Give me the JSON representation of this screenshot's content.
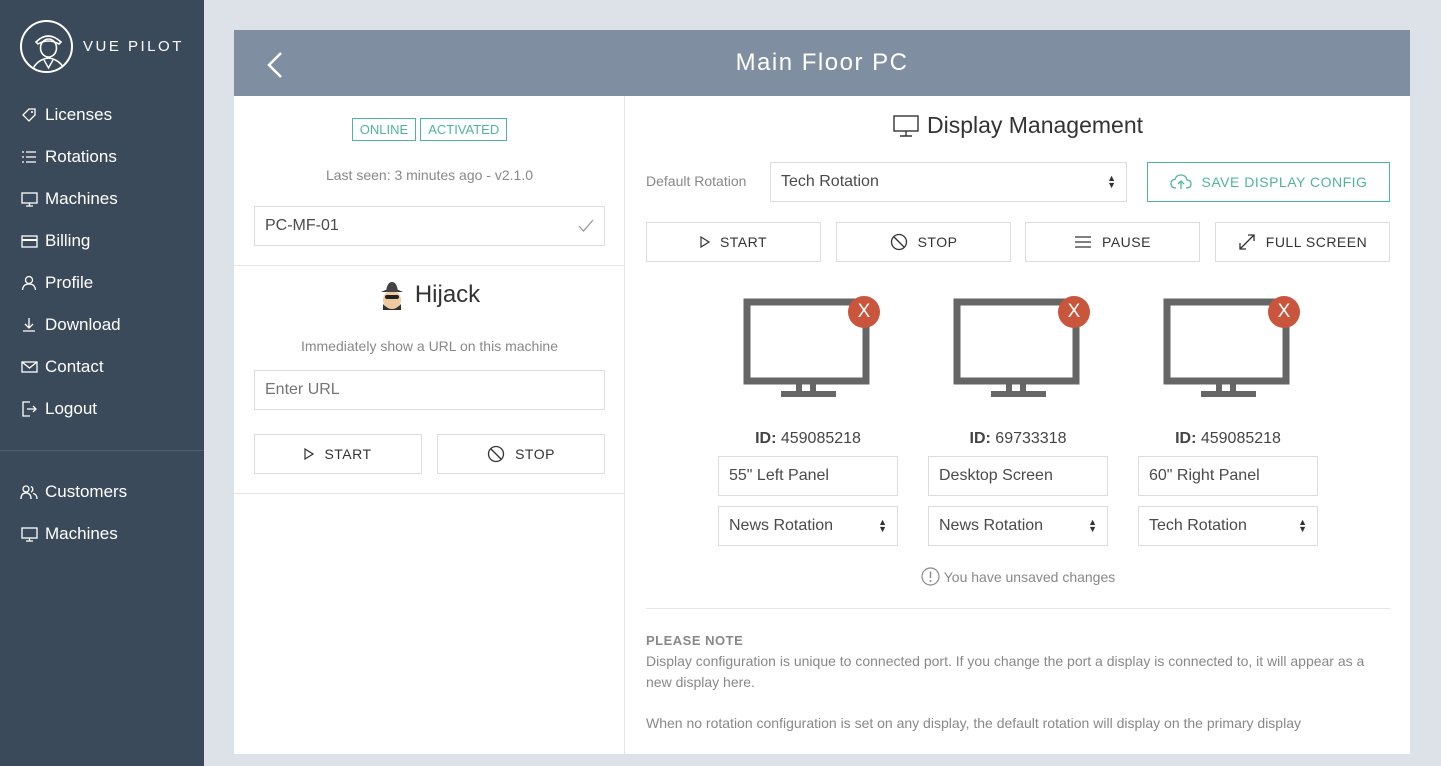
{
  "brand": {
    "name": "VUE PILOT"
  },
  "sidebar": {
    "items": [
      {
        "label": "Licenses",
        "icon": "tag-icon"
      },
      {
        "label": "Rotations",
        "icon": "list-icon"
      },
      {
        "label": "Machines",
        "icon": "monitor-icon"
      },
      {
        "label": "Billing",
        "icon": "credit-card-icon"
      },
      {
        "label": "Profile",
        "icon": "user-icon"
      },
      {
        "label": "Download",
        "icon": "download-icon"
      },
      {
        "label": "Contact",
        "icon": "mail-icon"
      },
      {
        "label": "Logout",
        "icon": "logout-icon"
      }
    ],
    "admin_items": [
      {
        "label": "Customers",
        "icon": "users-icon"
      },
      {
        "label": "Machines",
        "icon": "monitor-icon"
      }
    ]
  },
  "page": {
    "title": "Main Floor PC"
  },
  "machine": {
    "status_online": "ONLINE",
    "status_activated": "ACTIVATED",
    "last_seen": "Last seen: 3 minutes ago - v2.1.0",
    "id_value": "PC-MF-01"
  },
  "hijack": {
    "title": "Hijack",
    "description": "Immediately show a URL on this machine",
    "url_placeholder": "Enter URL",
    "start_label": "START",
    "stop_label": "STOP"
  },
  "display_management": {
    "title": "Display Management",
    "default_rotation_label": "Default Rotation",
    "default_rotation_value": "Tech Rotation",
    "save_label": "SAVE DISPLAY CONFIG",
    "controls": {
      "start": "START",
      "stop": "STOP",
      "pause": "PAUSE",
      "fullscreen": "FULL SCREEN"
    },
    "id_prefix": "ID:",
    "close_label": "X",
    "displays": [
      {
        "id": "459085218",
        "name": "55\" Left Panel",
        "rotation": "News Rotation"
      },
      {
        "id": "69733318",
        "name": "Desktop Screen",
        "rotation": "News Rotation"
      },
      {
        "id": "459085218",
        "name": "60\" Right Panel",
        "rotation": "Tech Rotation"
      }
    ],
    "unsaved_message": "You have unsaved changes",
    "note_title": "PLEASE NOTE",
    "note_text": "Display configuration is unique to connected port. If you change the port a display is connected to, it will appear as a new display here.",
    "note_text2": "When no rotation configuration is set on any display, the default rotation will display on the primary display"
  },
  "colors": {
    "sidebar_bg": "#3b4a5a",
    "header_bg": "#7f8ea1",
    "accent_green": "#4fb59a",
    "danger_red": "#c9553c"
  }
}
